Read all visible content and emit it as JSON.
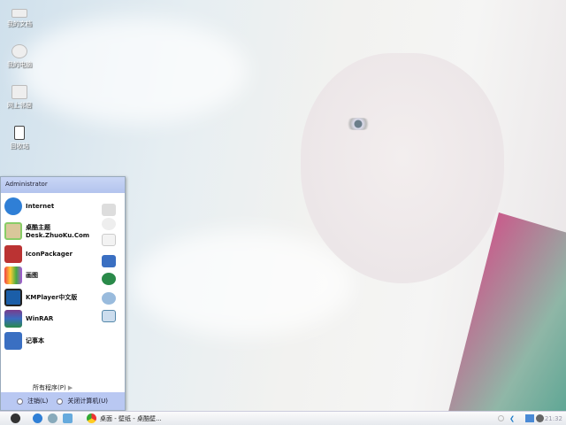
{
  "desktop": {
    "icons": [
      {
        "label": "我的文档"
      },
      {
        "label": "我的电脑"
      },
      {
        "label": "网上邻居"
      },
      {
        "label": "回收站"
      }
    ]
  },
  "start_menu": {
    "user": "Administrator",
    "items": [
      {
        "label": "Internet",
        "icon": "ie-icon"
      },
      {
        "label": "桌酷主题",
        "sub": "Desk.ZhuoKu.Com",
        "icon": "zhuoku-icon"
      },
      {
        "label": "IconPackager",
        "icon": "iconpackager-icon"
      },
      {
        "label": "画图",
        "icon": "paint-icon"
      },
      {
        "label": "KMPlayer中文版",
        "icon": "kmplayer-icon"
      },
      {
        "label": "WinRAR",
        "icon": "winrar-icon"
      },
      {
        "label": "记事本",
        "icon": "notepad-icon"
      }
    ],
    "all_programs": "所有程序(P)",
    "logoff": "注销(L)",
    "shutdown": "关闭计算机(U)"
  },
  "taskbar": {
    "window_title": "桌面 - 壁纸 - 桌酷壁...",
    "clock": "21:32"
  }
}
